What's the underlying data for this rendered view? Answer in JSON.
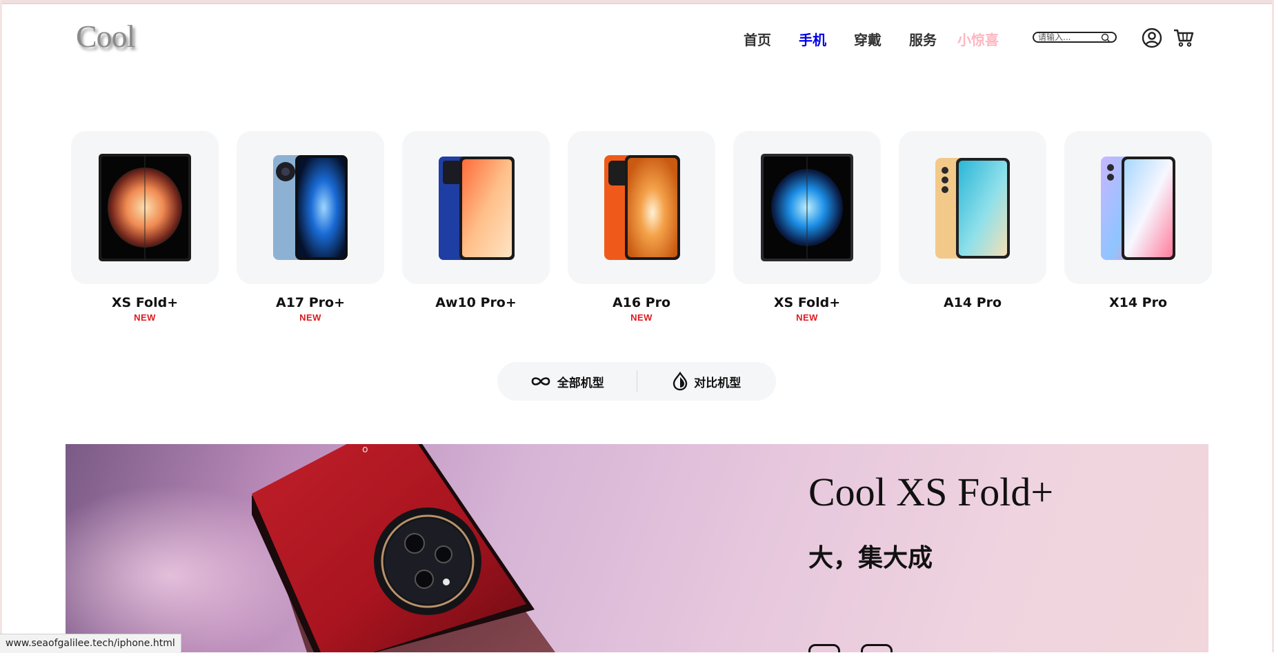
{
  "logo": {
    "text": "Cool"
  },
  "nav": {
    "items": [
      {
        "label": "首页"
      },
      {
        "label": "手机"
      },
      {
        "label": "穿戴"
      },
      {
        "label": "服务"
      },
      {
        "label": "小惊喜"
      }
    ],
    "active_index": 1
  },
  "search": {
    "placeholder": "请输入..."
  },
  "products": [
    {
      "name": "XS Fold+",
      "badge": "NEW"
    },
    {
      "name": "A17 Pro+",
      "badge": "NEW"
    },
    {
      "name": "Aw10 Pro+",
      "badge": ""
    },
    {
      "name": "A16 Pro",
      "badge": "NEW"
    },
    {
      "name": "XS Fold+",
      "badge": "NEW"
    },
    {
      "name": "A14 Pro",
      "badge": ""
    },
    {
      "name": "X14 Pro",
      "badge": ""
    }
  ],
  "actions": {
    "all_models": "全部机型",
    "compare": "对比机型"
  },
  "banner": {
    "title": "Cool XS Fold+",
    "subtitle": "大，集大成"
  },
  "status_bar": {
    "url": "www.seaofgalilee.tech/iphone.html"
  },
  "colors": {
    "nav_active": "#0000e6",
    "nav_promo": "#ffb6c1",
    "badge_new": "#e0191f",
    "card_bg": "#f5f6f8"
  }
}
